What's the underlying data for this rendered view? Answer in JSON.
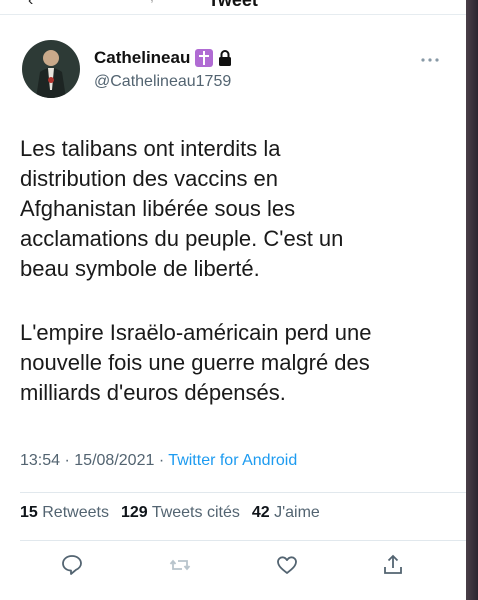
{
  "header": {
    "title": "Tweet"
  },
  "author": {
    "display_name": "Cathelineau",
    "handle": "@Cathelineau1759"
  },
  "tweet": {
    "paragraph1": "Les talibans ont interdits la\ndistribution des vaccins en\nAfghanistan libérée sous les\nacclamations du peuple. C'est un\nbeau symbole de liberté.",
    "paragraph2": "L'empire Israëlo-américain perd une\nnouvelle fois une guerre malgré des\nmilliards d'euros dépensés."
  },
  "meta": {
    "time": "13:54",
    "date": "15/08/2021",
    "source": "Twitter for Android"
  },
  "stats": {
    "retweets_count": "15",
    "retweets_label": "Retweets",
    "quotes_count": "129",
    "quotes_label": "Tweets cités",
    "likes_count": "42",
    "likes_label": "J'aime"
  },
  "icons": {
    "reply": "reply-icon",
    "retweet": "retweet-icon",
    "like": "like-icon",
    "share": "share-icon",
    "badge": "cross-badge-icon",
    "lock": "lock-icon",
    "more": "more-icon"
  },
  "colors": {
    "link": "#1d9bf0",
    "secondary_text": "#536471",
    "badge": "#b06bd3"
  }
}
